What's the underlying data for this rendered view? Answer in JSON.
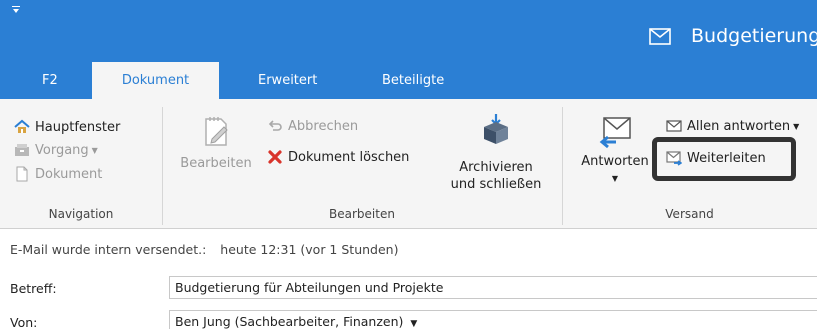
{
  "window": {
    "title": "Budgetierung"
  },
  "tabs": [
    {
      "label": "F2"
    },
    {
      "label": "Dokument"
    },
    {
      "label": "Erweitert"
    },
    {
      "label": "Beteiligte"
    }
  ],
  "ribbon": {
    "navigation": {
      "label": "Navigation",
      "hauptfenster": "Hauptfenster",
      "vorgang": "Vorgang",
      "dokument": "Dokument"
    },
    "bearbeiten": {
      "label": "Bearbeiten",
      "bearbeiten_btn": "Bearbeiten",
      "abbrechen": "Abbrechen",
      "dokument_loeschen": "Dokument löschen",
      "archivieren_line1": "Archivieren",
      "archivieren_line2": "und schließen"
    },
    "versand": {
      "label": "Versand",
      "antworten": "Antworten",
      "allen_antworten": "Allen antworten",
      "weiterleiten": "Weiterleiten"
    }
  },
  "mail": {
    "sent_label": "E-Mail wurde intern versendet.:",
    "sent_value": "heute 12:31 (vor 1 Stunden)",
    "betreff_label": "Betreff:",
    "betreff_value": "Budgetierung für Abteilungen und Projekte",
    "von_label": "Von:",
    "von_value": "Ben Jung (Sachbearbeiter, Finanzen)"
  },
  "colors": {
    "accent": "#2b7fd4",
    "ribbon_bg": "#f5f5f5",
    "delete_red": "#d9342b",
    "highlight_border": "#333333"
  }
}
